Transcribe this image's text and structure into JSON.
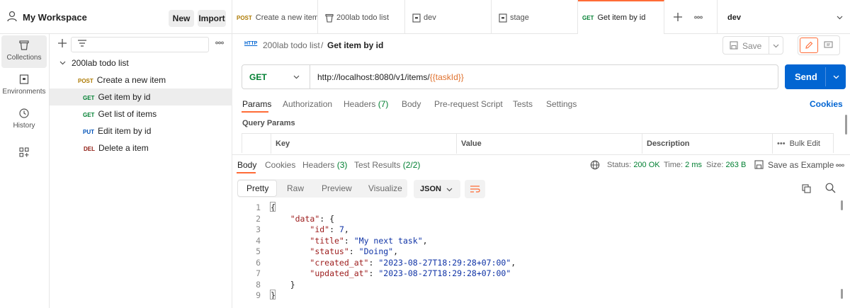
{
  "workspace": {
    "title": "My Workspace",
    "new_label": "New",
    "import_label": "Import"
  },
  "rail": {
    "items": [
      {
        "label": "Collections",
        "icon": "trash-can-icon"
      },
      {
        "label": "Environments",
        "icon": "environment-icon"
      },
      {
        "label": "History",
        "icon": "history-icon"
      },
      {
        "label": "",
        "icon": "add-grid-icon"
      }
    ]
  },
  "tree": {
    "collection": "200lab todo list",
    "requests": [
      {
        "method": "POST",
        "name": "Create a new item"
      },
      {
        "method": "GET",
        "name": "Get item by id"
      },
      {
        "method": "GET",
        "name": "Get list of items"
      },
      {
        "method": "PUT",
        "name": "Edit item by id"
      },
      {
        "method": "DEL",
        "name": "Delete a item"
      }
    ]
  },
  "tabs": [
    {
      "method": "POST",
      "label": "Create a new item"
    },
    {
      "method": "",
      "label": "200lab todo list"
    },
    {
      "method": "",
      "label": "dev"
    },
    {
      "method": "",
      "label": "stage"
    },
    {
      "method": "GET",
      "label": "Get item by id"
    }
  ],
  "environment": {
    "selected": "dev"
  },
  "breadcrumb": {
    "collection": "200lab todo list",
    "separator": "/",
    "request": "Get item by id",
    "http_badge": "HTTP"
  },
  "toolbar": {
    "save_label": "Save"
  },
  "request": {
    "method": "GET",
    "url_prefix": "http://localhost:8080/v1/items/",
    "url_var": "{{taskId}}",
    "send_label": "Send"
  },
  "request_tabs": {
    "params": "Params",
    "authorization": "Authorization",
    "headers": "Headers",
    "headers_count": "(7)",
    "body": "Body",
    "prerequest": "Pre-request Script",
    "tests": "Tests",
    "settings": "Settings",
    "cookies": "Cookies"
  },
  "query_params": {
    "title": "Query Params",
    "columns": {
      "key": "Key",
      "value": "Value",
      "description": "Description"
    },
    "bulk_edit": "Bulk Edit"
  },
  "response": {
    "tabs": {
      "body": "Body",
      "cookies": "Cookies",
      "headers": "Headers",
      "headers_count": "(3)",
      "tests": "Test Results",
      "tests_count": "(2/2)"
    },
    "status_label": "Status:",
    "status_value": "200 OK",
    "time_label": "Time:",
    "time_value": "2 ms",
    "size_label": "Size:",
    "size_value": "263 B",
    "save_example": "Save as Example",
    "views": {
      "pretty": "Pretty",
      "raw": "Raw",
      "preview": "Preview",
      "visualize": "Visualize"
    },
    "format": "JSON"
  },
  "code_lines": [
    {
      "n": "1",
      "parts": [
        [
          "p",
          "{"
        ]
      ]
    },
    {
      "n": "2",
      "parts": [
        [
          "p",
          "    "
        ],
        [
          "k",
          "\"data\""
        ],
        [
          "p",
          ": {"
        ]
      ]
    },
    {
      "n": "3",
      "parts": [
        [
          "p",
          "        "
        ],
        [
          "k",
          "\"id\""
        ],
        [
          "p",
          ": "
        ],
        [
          "n",
          "7"
        ],
        [
          "p",
          ","
        ]
      ]
    },
    {
      "n": "4",
      "parts": [
        [
          "p",
          "        "
        ],
        [
          "k",
          "\"title\""
        ],
        [
          "p",
          ": "
        ],
        [
          "s",
          "\"My next task\""
        ],
        [
          "p",
          ","
        ]
      ]
    },
    {
      "n": "5",
      "parts": [
        [
          "p",
          "        "
        ],
        [
          "k",
          "\"status\""
        ],
        [
          "p",
          ": "
        ],
        [
          "s",
          "\"Doing\""
        ],
        [
          "p",
          ","
        ]
      ]
    },
    {
      "n": "6",
      "parts": [
        [
          "p",
          "        "
        ],
        [
          "k",
          "\"created_at\""
        ],
        [
          "p",
          ": "
        ],
        [
          "s",
          "\"2023-08-27T18:29:28+07:00\""
        ],
        [
          "p",
          ","
        ]
      ]
    },
    {
      "n": "7",
      "parts": [
        [
          "p",
          "        "
        ],
        [
          "k",
          "\"updated_at\""
        ],
        [
          "p",
          ": "
        ],
        [
          "s",
          "\"2023-08-27T18:29:28+07:00\""
        ]
      ]
    },
    {
      "n": "8",
      "parts": [
        [
          "p",
          "    }"
        ]
      ]
    },
    {
      "n": "9",
      "parts": [
        [
          "p",
          "}"
        ]
      ]
    }
  ]
}
